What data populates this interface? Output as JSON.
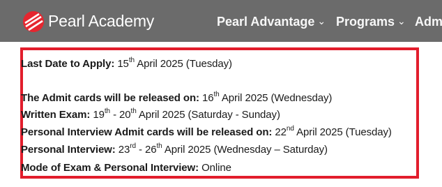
{
  "header": {
    "brand": "Pearl Academy",
    "nav": [
      {
        "label": "Pearl Advantage"
      },
      {
        "label": "Programs"
      },
      {
        "label": "Adm"
      }
    ]
  },
  "schedule": {
    "apply": {
      "label": "Last Date to Apply:",
      "d1": "15",
      "s1": "th",
      "rest": " April 2025 (Tuesday)"
    },
    "admit": {
      "label": "The Admit cards will be released on:",
      "d1": "16",
      "s1": "th",
      "rest": " April 2025 (Wednesday)"
    },
    "written": {
      "label": "Written Exam:",
      "d1": "19",
      "s1": "th",
      "mid": " - 20",
      "s2": "th",
      "rest": " April 2025 (Saturday - Sunday)"
    },
    "pi_admit": {
      "label": "Personal Interview Admit cards will be released on:",
      "d1": "22",
      "s1": "nd",
      "rest": " April 2025 (Tuesday)"
    },
    "interview": {
      "label": "Personal Interview:",
      "d1": "23",
      "s1": "rd",
      "mid": " - 26",
      "s2": "th",
      "rest": " April 2025 (Wednesday – Saturday)"
    },
    "mode": {
      "label": "Mode of Exam & Personal Interview:",
      "value": "Online"
    }
  }
}
